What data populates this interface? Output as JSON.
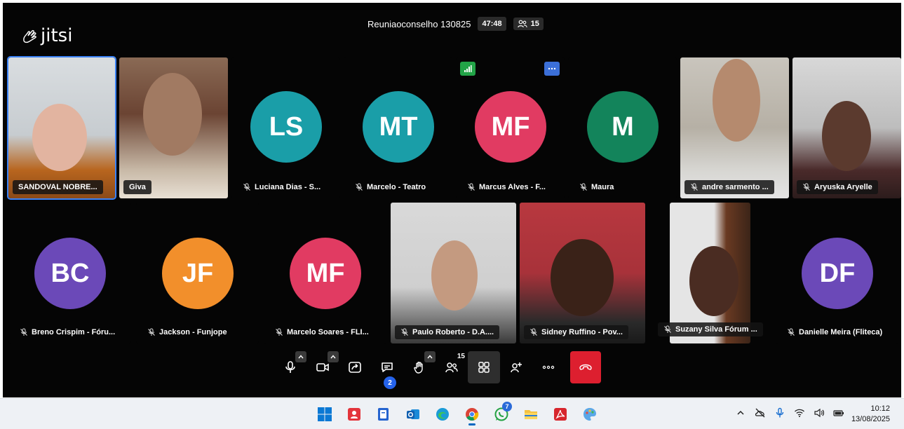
{
  "app": {
    "logo_text": "jitsi"
  },
  "header": {
    "meeting_name": "Reuniaoconselho 130825",
    "timer": "47:48",
    "participant_count": "15"
  },
  "participants": [
    {
      "name": "SANDOVAL NOBRE...",
      "type": "video"
    },
    {
      "name": "Giva",
      "type": "video"
    },
    {
      "name": "Luciana Dias - S...",
      "initials": "LS",
      "color": "#1a9ea8"
    },
    {
      "name": "Marcelo - Teatro",
      "initials": "MT",
      "color": "#1a9ea8"
    },
    {
      "name": "Marcus Alves - F...",
      "initials": "MF",
      "color": "#e13b62"
    },
    {
      "name": "Maura",
      "initials": "M",
      "color": "#13845b"
    },
    {
      "name": "andre sarmento ...",
      "type": "video"
    },
    {
      "name": "Aryuska Aryelle",
      "type": "video"
    },
    {
      "name": "Breno Crispim - Fóru...",
      "initials": "BC",
      "color": "#6b49b8"
    },
    {
      "name": "Jackson - Funjope",
      "initials": "JF",
      "color": "#f28f2b"
    },
    {
      "name": "Marcelo Soares - FLI...",
      "initials": "MF",
      "color": "#e13b62"
    },
    {
      "name": "Paulo Roberto - D.A....",
      "type": "video"
    },
    {
      "name": "Sidney Ruffino - Pov...",
      "type": "video"
    },
    {
      "name": "Suzany Silva Fórum ...",
      "type": "video"
    },
    {
      "name": "Danielle Meira (Fliteca)",
      "initials": "DF",
      "color": "#6b49b8"
    }
  ],
  "toolbar": {
    "participants_badge": "15",
    "chat_badge": "2"
  },
  "taskbar": {
    "whatsapp_badge": "7",
    "time": "10:12",
    "date": "13/08/2025"
  },
  "colors": {
    "accent": "#3b82f6",
    "hangup": "#dd1f2f",
    "connection_good": "#22a447",
    "more_badge": "#3b6fd8"
  }
}
